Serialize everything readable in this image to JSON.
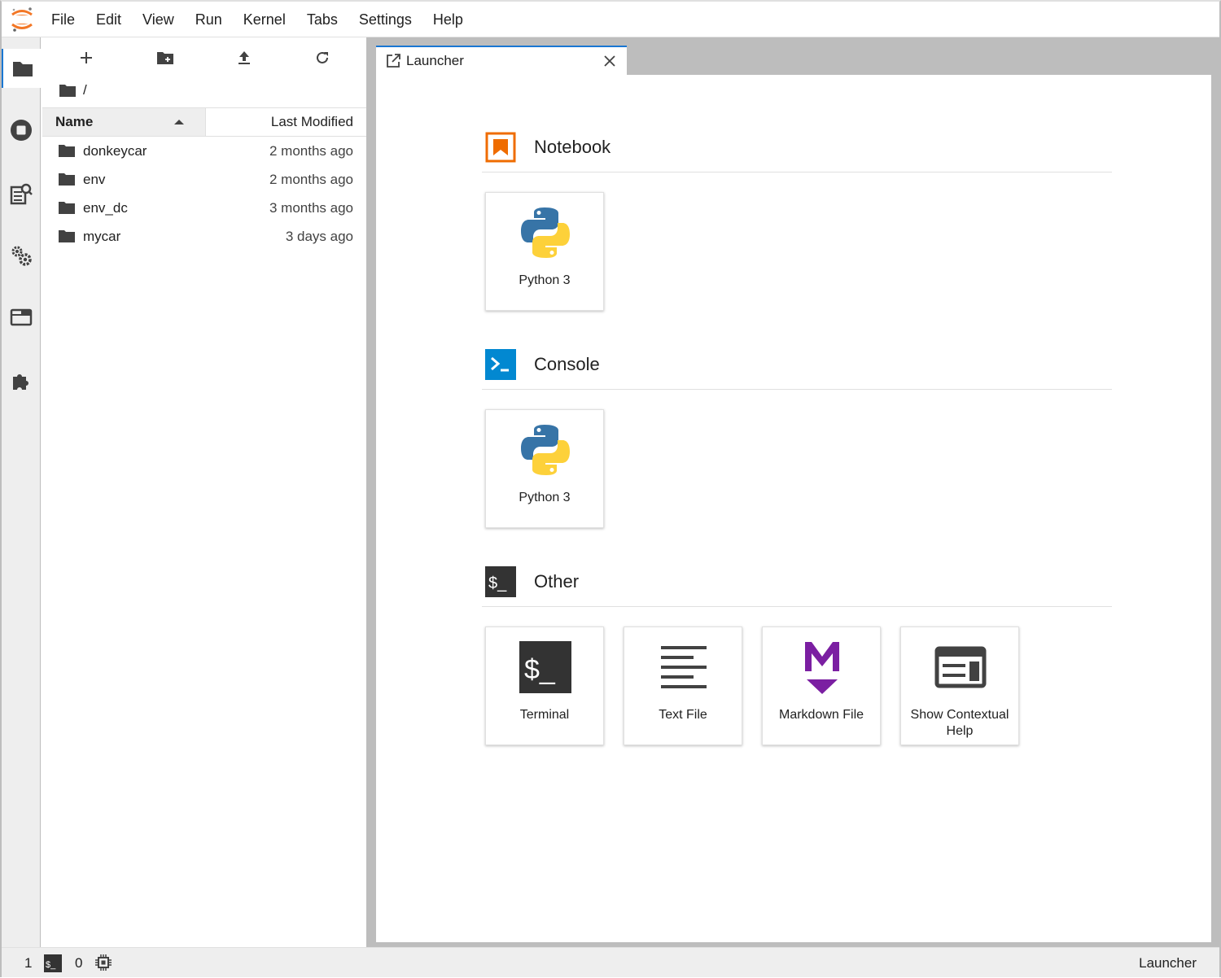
{
  "menu": {
    "items": [
      "File",
      "Edit",
      "View",
      "Run",
      "Kernel",
      "Tabs",
      "Settings",
      "Help"
    ]
  },
  "activity_bar": {
    "icons": [
      "folder-icon",
      "running-stop-icon",
      "command-palette-icon",
      "property-inspector-gears-icon",
      "tabs-window-icon",
      "extension-puzzle-icon"
    ],
    "active": "folder-icon"
  },
  "file_browser": {
    "breadcrumb": "/",
    "columns": {
      "name": "Name",
      "modified": "Last Modified"
    },
    "files": [
      {
        "name": "donkeycar",
        "modified": "2 months ago"
      },
      {
        "name": "env",
        "modified": "2 months ago"
      },
      {
        "name": "env_dc",
        "modified": "3 months ago"
      },
      {
        "name": "mycar",
        "modified": "3 days ago"
      }
    ]
  },
  "tab": {
    "label": "Launcher"
  },
  "launcher": {
    "sections": [
      {
        "title": "Notebook",
        "cards": [
          "Python 3"
        ]
      },
      {
        "title": "Console",
        "cards": [
          "Python 3"
        ]
      },
      {
        "title": "Other",
        "cards": [
          "Terminal",
          "Text File",
          "Markdown File",
          "Show Contextual Help"
        ]
      }
    ]
  },
  "statusbar": {
    "terminals_count": "1",
    "kernels_count": "0",
    "right_label": "Launcher"
  },
  "colors": {
    "accent_blue": "#1976d2",
    "notebook_orange": "#ef6c00",
    "console_blue": "#0288d1",
    "markdown_purple": "#7b1fa2",
    "jupyter_orange": "#f37726"
  }
}
